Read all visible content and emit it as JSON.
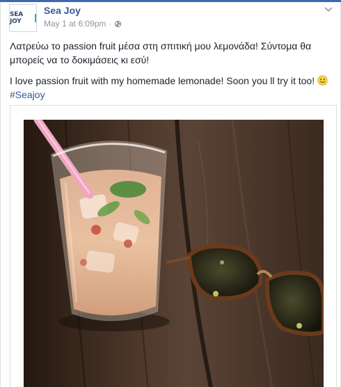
{
  "post": {
    "page_name": "Sea Joy",
    "timestamp": "May 1 at 6:09pm",
    "separator": "·",
    "avatar_text": "SEA JOY",
    "text_greek": "Λατρεύω το passion fruit μέσα στη σπιτική μου λεμονάδα! Σύντομα θα μπορείς να το δοκιμάσεις κι εσύ!",
    "text_english": "I love passion fruit with my homemade lemonade! Soon you ll try it too!",
    "hashtag": "#Seajoy",
    "icons": [
      "globe-icon",
      "chevron-down-icon",
      "smile-emoji-icon"
    ]
  },
  "colors": {
    "link": "#365899",
    "text": "#1d2129",
    "meta": "#90949c",
    "brand_accent": "#29a9d6"
  }
}
